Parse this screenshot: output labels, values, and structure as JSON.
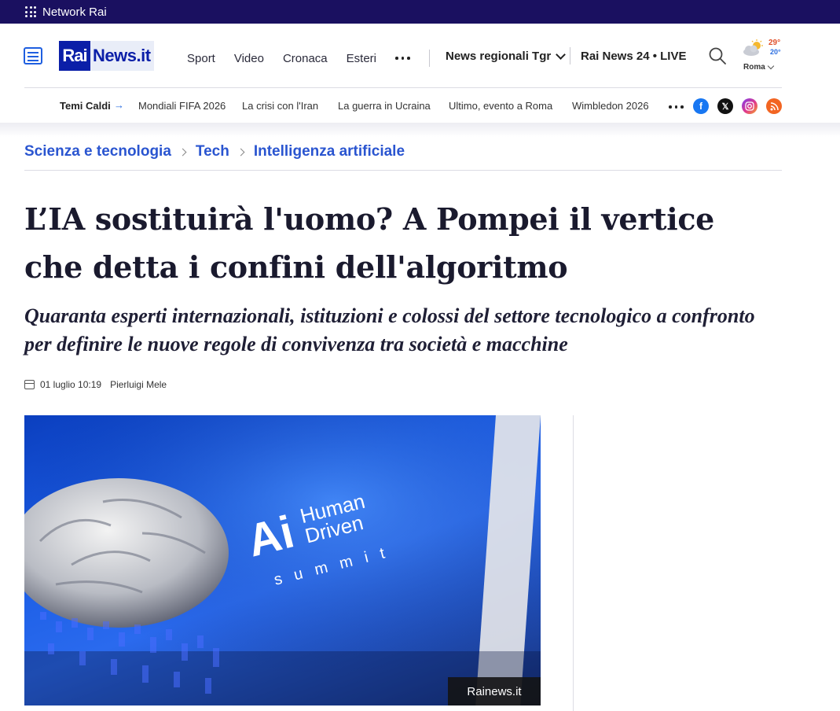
{
  "network_bar": {
    "label": "Network Rai"
  },
  "header": {
    "logo": {
      "rai": "Rai",
      "news": "News.it"
    },
    "nav": [
      "Sport",
      "Video",
      "Cronaca",
      "Esteri"
    ],
    "regional": "News regionali Tgr",
    "live": "Rai News 24 • LIVE",
    "weather": {
      "max": "29°",
      "min": "20°",
      "city": "Roma"
    }
  },
  "topics": {
    "label": "Temi Caldi",
    "items": [
      "Mondiali FIFA 2026",
      "La crisi con l'Iran",
      "La guerra in Ucraina",
      "Ultimo, evento a Roma",
      "Wimbledon 2026"
    ],
    "social": [
      "facebook-icon",
      "x-icon",
      "instagram-icon",
      "rss-icon"
    ]
  },
  "breadcrumb": [
    "Scienza e tecnologia",
    "Tech",
    "Intelligenza artificiale"
  ],
  "article": {
    "title": "L’IA sostituirà l'uomo? A Pompei il vertice che detta i confini dell'algoritmo",
    "subtitle": "Quaranta esperti internazionali, istituzioni e colossi del settore tecnologico a confronto per definire le nuove regole di convivenza tra società e macchine",
    "date": "01 luglio 10:19",
    "author": "Pierluigi Mele",
    "image_text": {
      "line1": "Human",
      "line2": "Driven",
      "line3": "summit",
      "mark": "Ai"
    },
    "image_caption": "Rainews.it"
  },
  "colors": {
    "network_bar": "#1a1060",
    "brand_blue": "#0b1fa8",
    "link_blue": "#2a55d0"
  }
}
